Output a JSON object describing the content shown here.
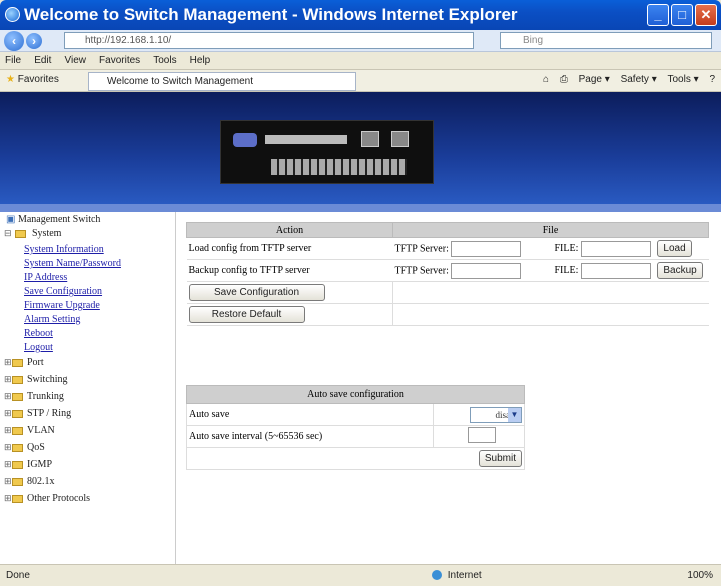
{
  "window": {
    "title": "Welcome to Switch Management - Windows Internet Explorer",
    "buttons": [
      "_",
      "□",
      "✕"
    ]
  },
  "address_bar": {
    "url": "http://192.168.1.10/",
    "search_placeholder": "Bing"
  },
  "menu": [
    "File",
    "Edit",
    "View",
    "Favorites",
    "Tools",
    "Help"
  ],
  "favorites_bar": {
    "favorites_label": "Favorites",
    "tab_title": "Welcome to Switch Management",
    "commands": [
      "Page ▾",
      "Safety ▾",
      "Tools ▾"
    ]
  },
  "sidebar": {
    "root": "Management Switch",
    "system_label": "System",
    "system_links": [
      "System Information",
      "System Name/Password",
      "IP Address",
      "Save Configuration",
      "Firmware Upgrade",
      "Alarm Setting",
      "Reboot",
      "Logout"
    ],
    "groups": [
      "Port",
      "Switching",
      "Trunking",
      "STP / Ring",
      "VLAN",
      "QoS",
      "IGMP",
      "802.1x",
      "Other Protocols"
    ]
  },
  "action_table": {
    "header_action": "Action",
    "header_file": "File",
    "row1_label": "Load config from TFTP server",
    "row2_label": "Backup config to TFTP server",
    "tftp_label": "TFTP Server:",
    "file_label": "FILE:",
    "load_button": "Load",
    "backup_button": "Backup",
    "save_button": "Save Configuration",
    "restore_button": "Restore Default"
  },
  "auto_save": {
    "header": "Auto save configuration",
    "auto_save_label": "Auto save",
    "auto_save_value": "disable",
    "interval_label": "Auto save interval (5~65536 sec)",
    "submit_button": "Submit"
  },
  "statusbar": {
    "status": "Done",
    "zone": "Internet",
    "zoom": "100%"
  }
}
